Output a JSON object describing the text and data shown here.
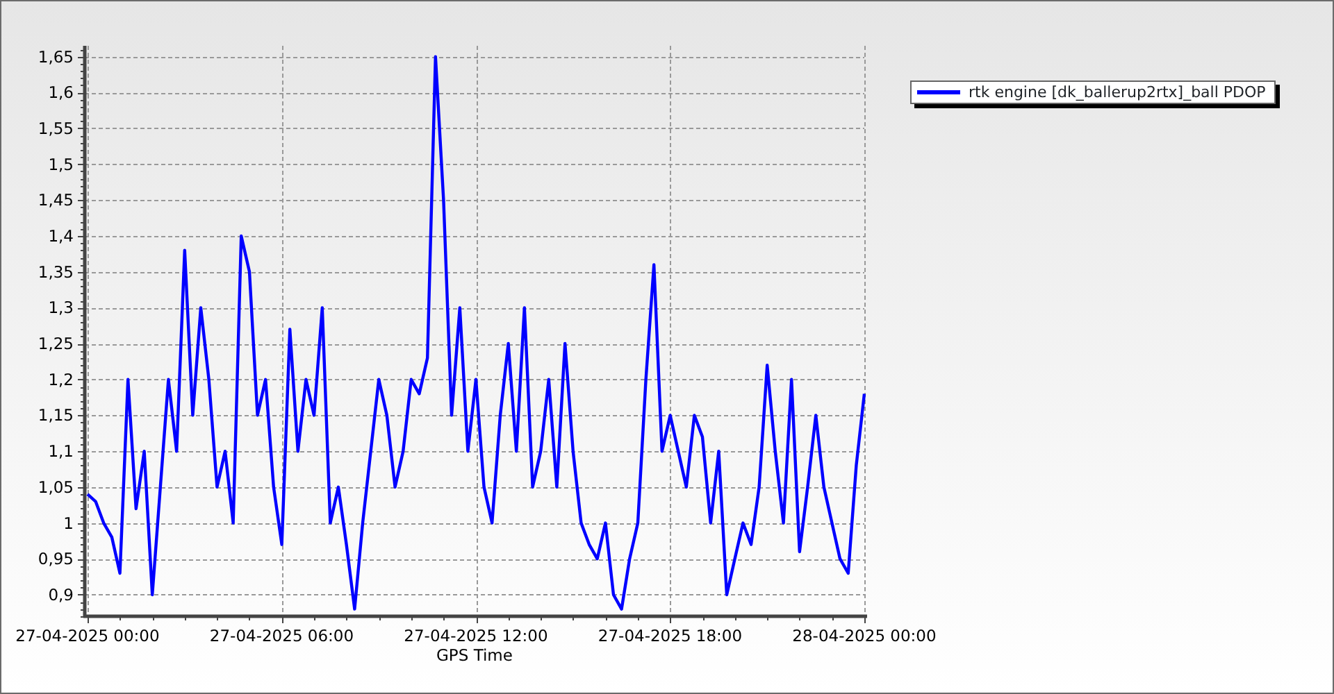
{
  "chart_data": {
    "type": "line",
    "xlabel": "GPS Time",
    "ylim": [
      0.87,
      1.665
    ],
    "grid": true,
    "yticks": [
      {
        "value": 0.9,
        "label": "0,9"
      },
      {
        "value": 0.95,
        "label": "0,95"
      },
      {
        "value": 1,
        "label": "1"
      },
      {
        "value": 1.05,
        "label": "1,05"
      },
      {
        "value": 1.1,
        "label": "1,1"
      },
      {
        "value": 1.15,
        "label": "1,15"
      },
      {
        "value": 1.2,
        "label": "1,2"
      },
      {
        "value": 1.25,
        "label": "1,25"
      },
      {
        "value": 1.3,
        "label": "1,3"
      },
      {
        "value": 1.35,
        "label": "1,35"
      },
      {
        "value": 1.4,
        "label": "1,4"
      },
      {
        "value": 1.45,
        "label": "1,45"
      },
      {
        "value": 1.5,
        "label": "1,5"
      },
      {
        "value": 1.55,
        "label": "1,55"
      },
      {
        "value": 1.6,
        "label": "1,6"
      },
      {
        "value": 1.65,
        "label": "1,65"
      }
    ],
    "categories": [
      "27-04-2025 00:00",
      null,
      null,
      null,
      null,
      null,
      null,
      null,
      null,
      null,
      null,
      null,
      null,
      null,
      null,
      null,
      null,
      null,
      null,
      null,
      null,
      null,
      null,
      null,
      "27-04-2025 06:00",
      null,
      null,
      null,
      null,
      null,
      null,
      null,
      null,
      null,
      null,
      null,
      null,
      null,
      null,
      null,
      null,
      null,
      null,
      null,
      null,
      null,
      null,
      null,
      "27-04-2025 12:00",
      null,
      null,
      null,
      null,
      null,
      null,
      null,
      null,
      null,
      null,
      null,
      null,
      null,
      null,
      null,
      null,
      null,
      null,
      null,
      null,
      null,
      null,
      null,
      "27-04-2025 18:00",
      null,
      null,
      null,
      null,
      null,
      null,
      null,
      null,
      null,
      null,
      null,
      null,
      null,
      null,
      null,
      null,
      null,
      null,
      null,
      null,
      null,
      null,
      null,
      "28-04-2025 00:00"
    ],
    "series": [
      {
        "name": "rtk engine [dk_ballerup2rtx]_ball PDOP",
        "color": "#0000ff",
        "values": [
          1.04,
          1.03,
          1.0,
          0.98,
          0.93,
          1.2,
          1.02,
          1.1,
          0.9,
          1.05,
          1.2,
          1.1,
          1.38,
          1.15,
          1.3,
          1.2,
          1.05,
          1.1,
          1.0,
          1.4,
          1.35,
          1.15,
          1.2,
          1.05,
          0.97,
          1.27,
          1.1,
          1.2,
          1.15,
          1.3,
          1.0,
          1.05,
          0.97,
          0.88,
          1.0,
          1.1,
          1.2,
          1.15,
          1.05,
          1.1,
          1.2,
          1.18,
          1.23,
          1.65,
          1.45,
          1.15,
          1.3,
          1.1,
          1.2,
          1.05,
          1.0,
          1.15,
          1.25,
          1.1,
          1.3,
          1.05,
          1.1,
          1.2,
          1.05,
          1.25,
          1.1,
          1.0,
          0.97,
          0.95,
          1.0,
          0.9,
          0.88,
          0.95,
          1.0,
          1.2,
          1.36,
          1.1,
          1.15,
          1.1,
          1.05,
          1.15,
          1.12,
          1.0,
          1.1,
          0.9,
          0.95,
          1.0,
          0.97,
          1.05,
          1.22,
          1.1,
          1.0,
          1.2,
          0.96,
          1.05,
          1.15,
          1.05,
          1.0,
          0.95,
          0.93,
          1.08,
          1.18
        ]
      }
    ]
  }
}
